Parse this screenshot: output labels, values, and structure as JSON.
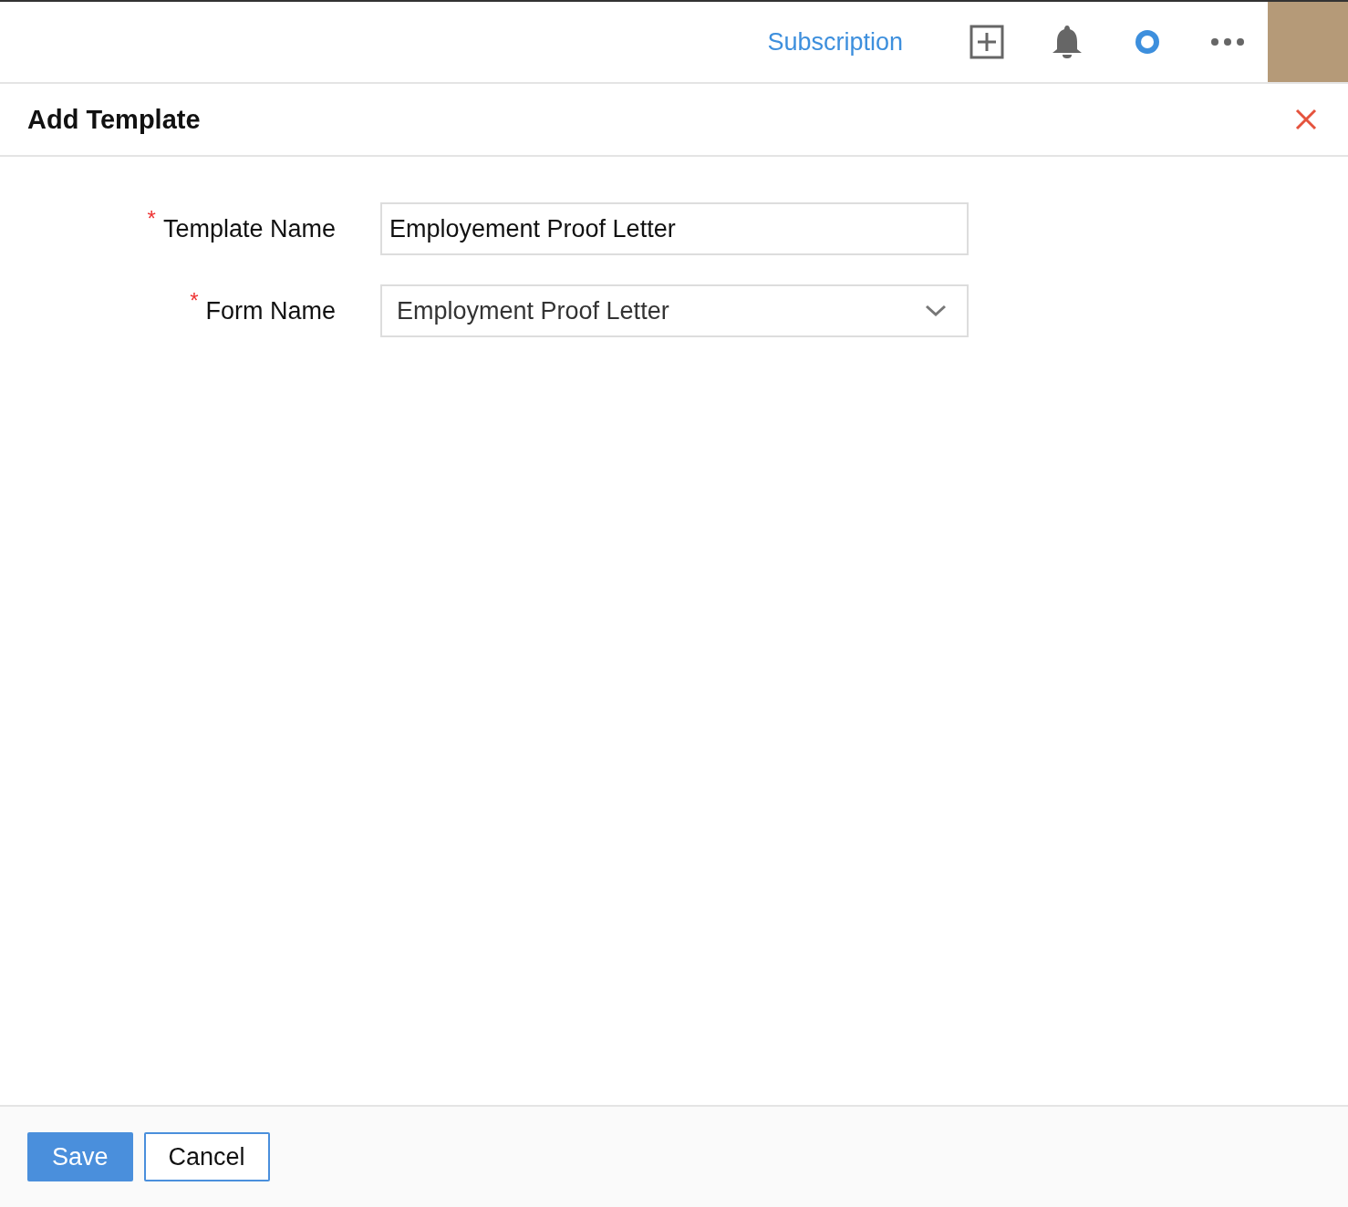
{
  "top_bar": {
    "subscription_link": "Subscription"
  },
  "panel": {
    "title": "Add Template"
  },
  "fields": [
    {
      "kind": "text",
      "label": "Template Name",
      "required_mark": "*",
      "value": "Employement Proof Letter"
    },
    {
      "kind": "select",
      "label": "Form Name",
      "required_mark": "*",
      "value": "Employment Proof Letter"
    }
  ],
  "buttons": [
    {
      "label": "Save",
      "kind": "primary"
    },
    {
      "label": "Cancel",
      "kind": "secondary"
    }
  ]
}
